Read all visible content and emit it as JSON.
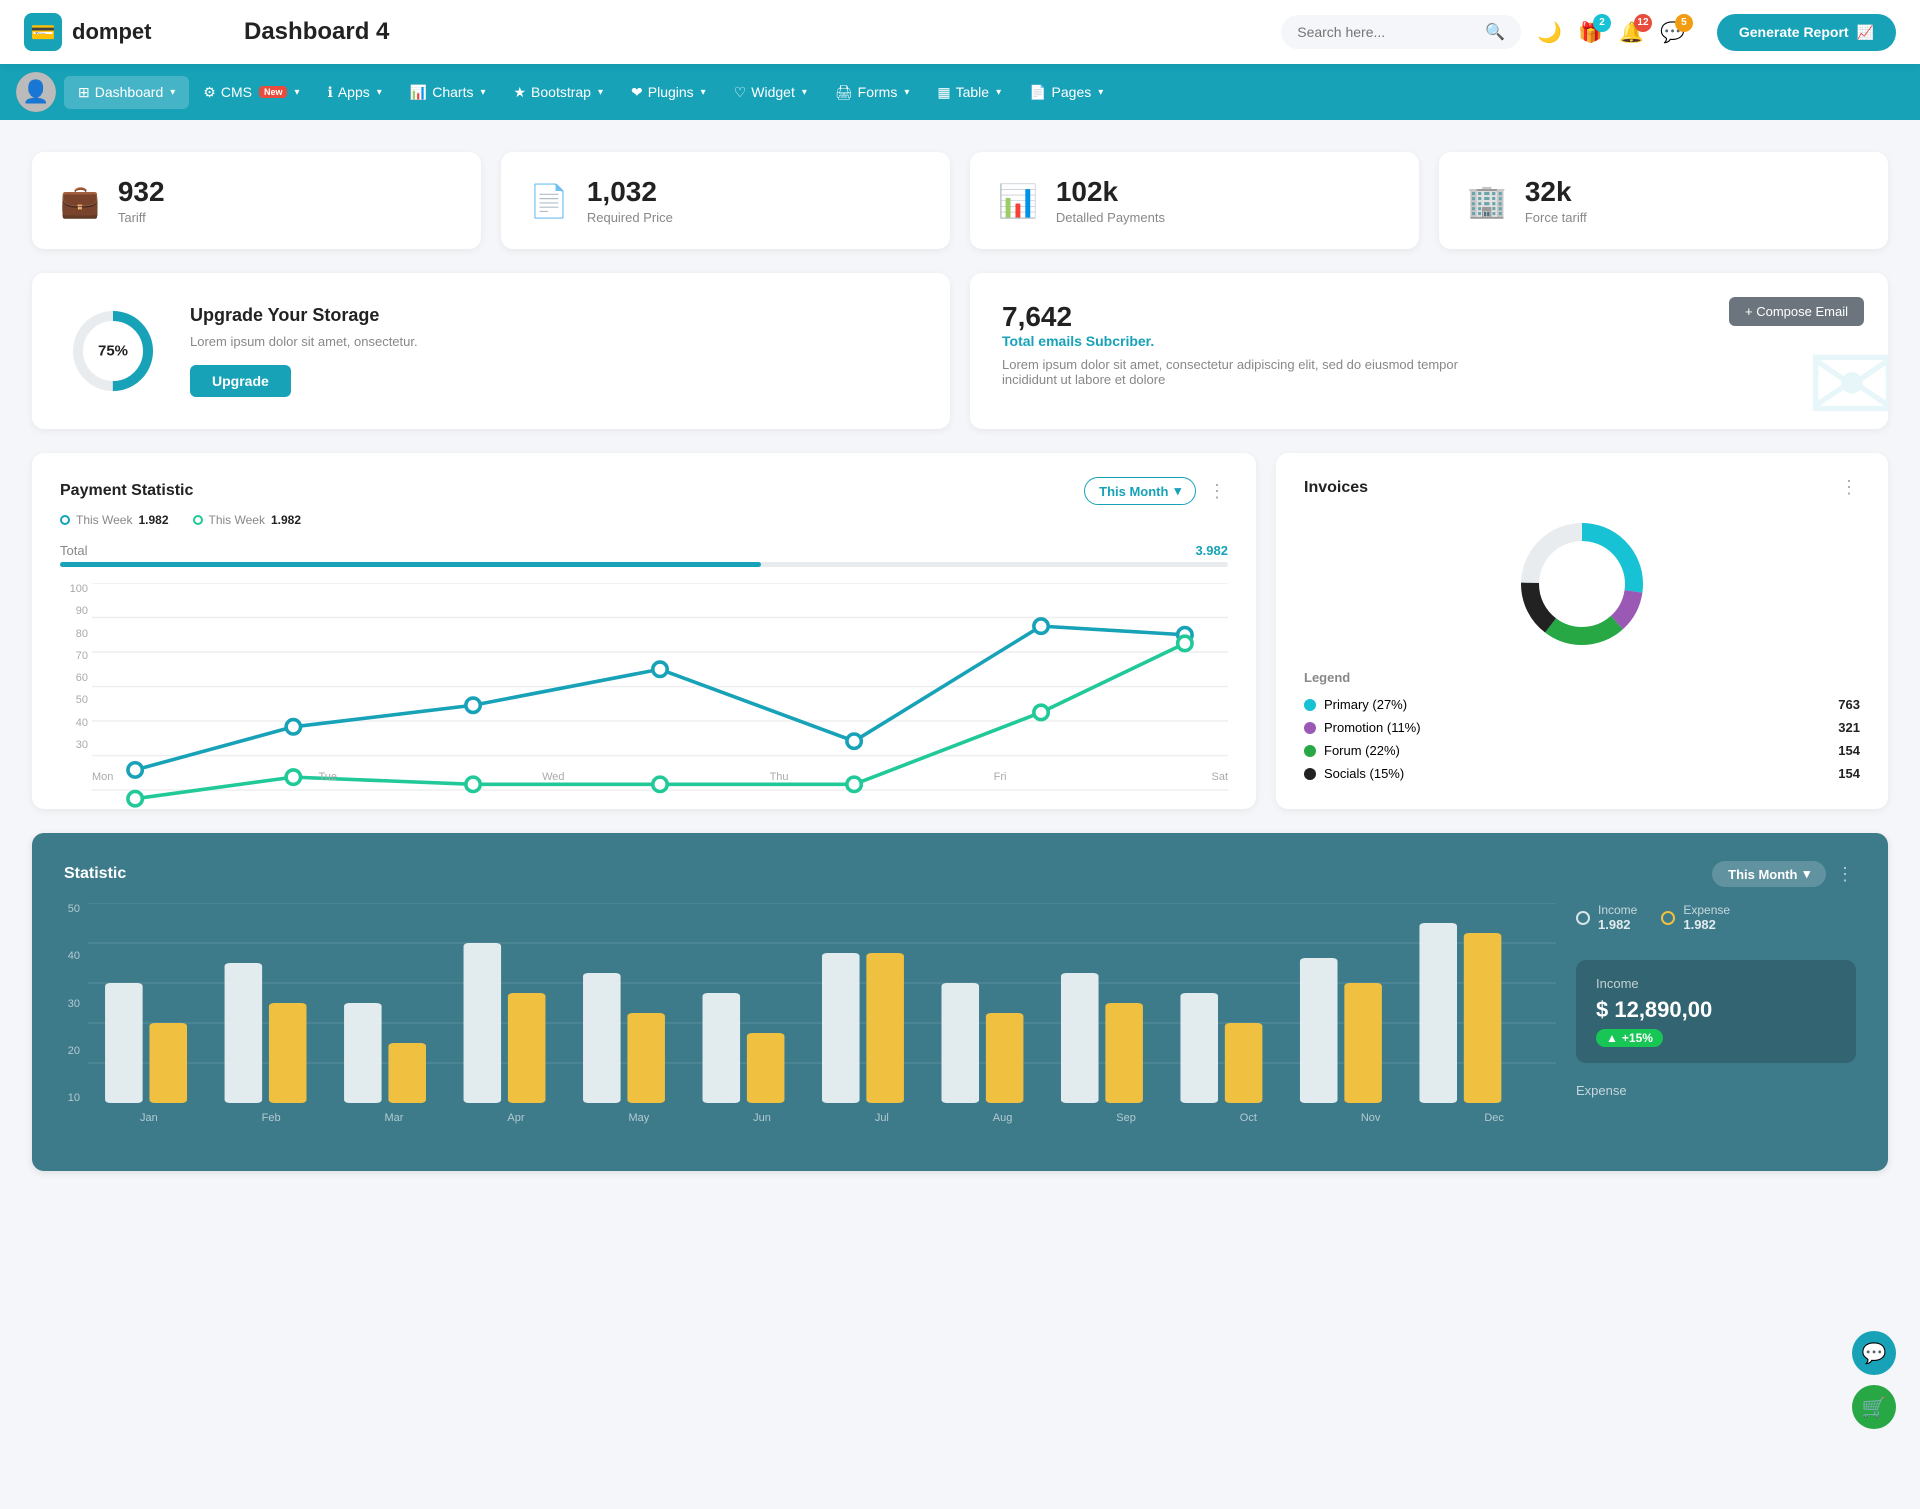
{
  "header": {
    "logo_text": "dompet",
    "page_title": "Dashboard 4",
    "search_placeholder": "Search here...",
    "generate_report_label": "Generate Report",
    "icons": {
      "dark_mode": "🌙",
      "gift": "🎁",
      "bell": "🔔",
      "chat": "💬"
    },
    "badges": {
      "gift": "2",
      "bell": "12",
      "chat": "5"
    }
  },
  "nav": {
    "items": [
      {
        "id": "dashboard",
        "label": "Dashboard",
        "active": true,
        "has_arrow": true,
        "badge": null
      },
      {
        "id": "cms",
        "label": "CMS",
        "active": false,
        "has_arrow": true,
        "badge": "New"
      },
      {
        "id": "apps",
        "label": "Apps",
        "active": false,
        "has_arrow": true,
        "badge": null
      },
      {
        "id": "charts",
        "label": "Charts",
        "active": false,
        "has_arrow": true,
        "badge": null
      },
      {
        "id": "bootstrap",
        "label": "Bootstrap",
        "active": false,
        "has_arrow": true,
        "badge": null
      },
      {
        "id": "plugins",
        "label": "Plugins",
        "active": false,
        "has_arrow": true,
        "badge": null
      },
      {
        "id": "widget",
        "label": "Widget",
        "active": false,
        "has_arrow": true,
        "badge": null
      },
      {
        "id": "forms",
        "label": "Forms",
        "active": false,
        "has_arrow": true,
        "badge": null
      },
      {
        "id": "table",
        "label": "Table",
        "active": false,
        "has_arrow": true,
        "badge": null
      },
      {
        "id": "pages",
        "label": "Pages",
        "active": false,
        "has_arrow": true,
        "badge": null
      }
    ]
  },
  "stat_cards": [
    {
      "id": "tariff",
      "icon": "💼",
      "icon_color": "#17a2b8",
      "value": "932",
      "label": "Tariff"
    },
    {
      "id": "required_price",
      "icon": "📄",
      "icon_color": "#e74c3c",
      "value": "1,032",
      "label": "Required Price"
    },
    {
      "id": "detailed_payments",
      "icon": "📊",
      "icon_color": "#9b59b6",
      "value": "102k",
      "label": "Detalled Payments"
    },
    {
      "id": "force_tariff",
      "icon": "🏢",
      "icon_color": "#e91e8c",
      "value": "32k",
      "label": "Force tariff"
    }
  ],
  "storage": {
    "percent": 75,
    "percent_label": "75%",
    "title": "Upgrade Your Storage",
    "description": "Lorem ipsum dolor sit amet, onsectetur.",
    "button_label": "Upgrade"
  },
  "email": {
    "count": "7,642",
    "sub_title": "Total emails Subcriber.",
    "description": "Lorem ipsum dolor sit amet, consectetur adipiscing elit, sed do eiusmod tempor incididunt ut labore et dolore",
    "compose_btn_label": "+ Compose Email"
  },
  "payment_statistic": {
    "title": "Payment Statistic",
    "month_label": "This Month",
    "this_week_1_label": "This Week",
    "this_week_1_val": "1.982",
    "this_week_2_label": "This Week",
    "this_week_2_val": "1.982",
    "total_label": "Total",
    "total_val": "3.982",
    "x_labels": [
      "Mon",
      "Tue",
      "Wed",
      "Thu",
      "Fri",
      "Sat"
    ],
    "y_labels": [
      "100",
      "90",
      "80",
      "70",
      "60",
      "50",
      "40",
      "30"
    ],
    "line1_points": "30,145 120,110 200,95 310,75 430,120 540,100 650,40 760,45",
    "line2_points": "30,165 120,150 200,155 310,155 430,155 540,160 650,100 760,50"
  },
  "invoices": {
    "title": "Invoices",
    "legend": [
      {
        "id": "primary",
        "label": "Primary (27%)",
        "color": "#17c2d4",
        "value": "763"
      },
      {
        "id": "promotion",
        "label": "Promotion (11%)",
        "color": "#9b59b6",
        "value": "321"
      },
      {
        "id": "forum",
        "label": "Forum (22%)",
        "color": "#28a745",
        "value": "154"
      },
      {
        "id": "socials",
        "label": "Socials (15%)",
        "color": "#222",
        "value": "154"
      }
    ],
    "legend_title": "Legend"
  },
  "statistic": {
    "title": "Statistic",
    "month_label": "This Month",
    "income_label": "Income",
    "income_val": "1.982",
    "expense_label": "Expense",
    "expense_val": "1.982",
    "income_box_title": "Income",
    "income_box_val": "$ 12,890,00",
    "income_badge": "+15%",
    "x_labels": [
      "Jan",
      "Feb",
      "Mar",
      "Apr",
      "May",
      "Jun",
      "Jul",
      "Aug",
      "Sep",
      "Oct",
      "Nov",
      "Dec"
    ],
    "y_labels": [
      "50",
      "40",
      "30",
      "20",
      "10"
    ]
  },
  "floating": {
    "chat_icon": "💬",
    "cart_icon": "🛒"
  }
}
